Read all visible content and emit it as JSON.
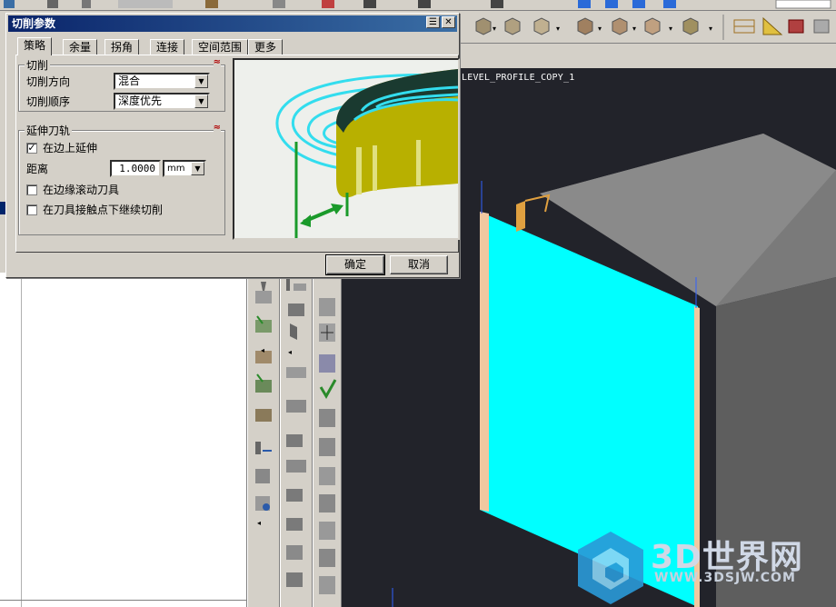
{
  "dialog": {
    "title": "切削参数",
    "tabs": [
      {
        "label": "策略",
        "active": true
      },
      {
        "label": "余量",
        "active": false
      },
      {
        "label": "拐角",
        "active": false
      },
      {
        "label": "连接",
        "active": false
      },
      {
        "label": "空间范围",
        "active": false
      },
      {
        "label": "更多",
        "active": false
      }
    ],
    "cutting": {
      "group_title": "切削",
      "direction_label": "切削方向",
      "direction_value": "混合",
      "order_label": "切削顺序",
      "order_value": "深度优先"
    },
    "extend": {
      "group_title": "延伸刀轨",
      "extend_on_edge_label": "在边上延伸",
      "extend_on_edge_checked": true,
      "distance_label": "距离",
      "distance_value": "1.0000",
      "distance_unit": "mm",
      "roll_tool_label": "在边缘滚动刀具",
      "roll_tool_checked": false,
      "continue_cut_label": "在刀具接触点下继续切削",
      "continue_cut_checked": false
    },
    "ok_label": "确定",
    "cancel_label": "取消",
    "collapse_glyph": "≈",
    "window_buttons": [
      "☰",
      "✕"
    ]
  },
  "viewport": {
    "operation_name": "LEVEL_PROFILE_COPY_1",
    "background_color": "#22232a",
    "surface_color": "#00ffff",
    "block_color": "#8c8c8c"
  },
  "watermark": {
    "text": "3D世界网",
    "url": "WWW.3DSJW.COM"
  },
  "colors": {
    "title_bar": "#0a246a",
    "toolpath": "#33ddee",
    "part_body": "#b8b000",
    "arrow": "#1a9a2a"
  }
}
